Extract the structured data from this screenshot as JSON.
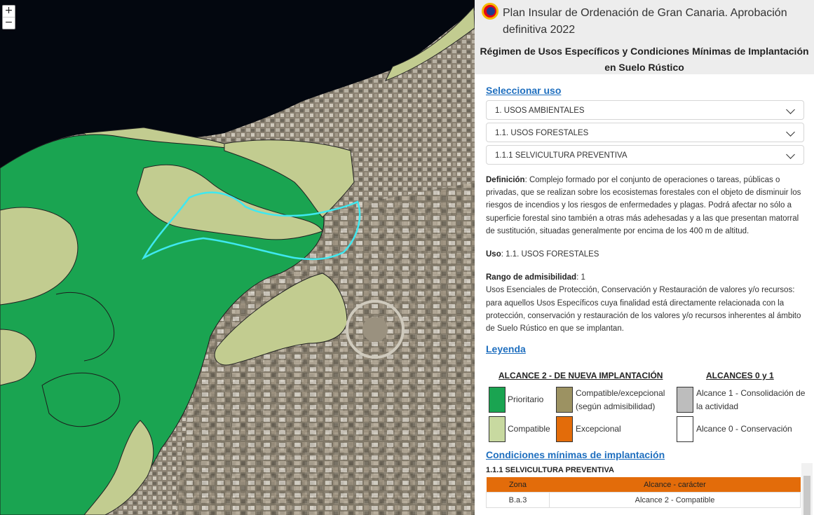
{
  "map": {
    "zoom_in": "+",
    "zoom_out": "−",
    "colors": {
      "sea": "#03070f",
      "prioritario": "#1aa451",
      "compatible": "#c2cc90",
      "highlight": "#3fe8f0"
    }
  },
  "header": {
    "title": "Plan Insular de Ordenación de Gran Canaria. Aprobación definitiva 2022",
    "subtitle": "Régimen de Usos Específicos y Condiciones Mínimas de Implantación en Suelo Rústico"
  },
  "select": {
    "label": "Seleccionar uso",
    "options": [
      "1. USOS AMBIENTALES",
      "1.1. USOS FORESTALES",
      "1.1.1 SELVICULTURA PREVENTIVA"
    ]
  },
  "info": {
    "definicion_label": "Definición",
    "definicion_text": ": Complejo formado por el conjunto de operaciones o tareas, públicas o privadas, que se realizan sobre los ecosistemas forestales con el objeto de disminuir los riesgos de incendios y los riesgos de enfermedades y plagas. Podrá afectar no sólo a superficie forestal sino también a otras más adehesadas y a las que presentan matorral de sustitución, situadas generalmente por encima de los 400 m de altitud.",
    "uso_label": "Uso",
    "uso_text": ": 1.1. USOS FORESTALES",
    "rango_label": "Rango de admisibilidad",
    "rango_text": ": 1",
    "rango_desc": "Usos Esenciales de Protección, Conservación y Restauración de valores y/o recursos: para aquellos Usos Específicos cuya finalidad está directamente relacionada con la protección, conservación y restauración de los valores y/o recursos inherentes al ámbito de Suelo Rústico en que se implantan."
  },
  "legend": {
    "title": "Leyenda",
    "head_left": "ALCANCE 2 - DE NUEVA IMPLANTACIÓN",
    "head_right": "ALCANCES 0 y 1",
    "items": [
      {
        "label": "Prioritario",
        "color": "#1aa451"
      },
      {
        "label": "Compatible/excepcional (según admisibilidad)",
        "color": "#9c9262"
      },
      {
        "label": "Alcance 1 - Consolidación de la actividad",
        "color": "#bdbdbd"
      },
      {
        "label": "Compatible",
        "color": "#c8d9a0"
      },
      {
        "label": "Excepcional",
        "color": "#e36c0a"
      },
      {
        "label": "Alcance 0 - Conservación",
        "color": "#ffffff"
      }
    ]
  },
  "conditions": {
    "title": "Condiciones mínimas de implantación",
    "subtitle": "1.1.1 SELVICULTURA PREVENTIVA",
    "columns": [
      "Zona",
      "Alcance - carácter"
    ],
    "rows": [
      [
        "B.a.3",
        "Alcance 2 - Compatible"
      ]
    ]
  }
}
